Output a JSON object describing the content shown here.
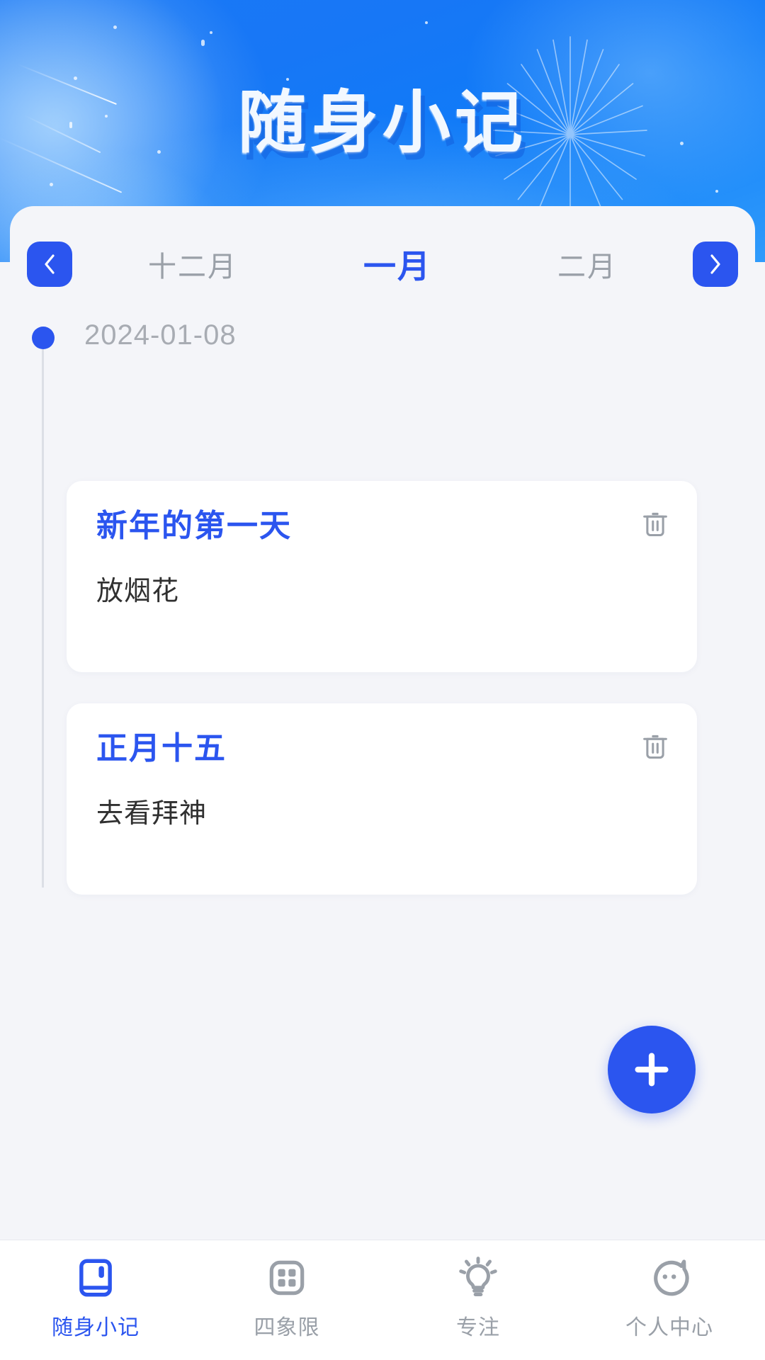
{
  "header": {
    "title": "随身小记",
    "gradient_from": "#1a78f5",
    "gradient_to": "#2f9bfb"
  },
  "theme": {
    "accent": "#2b55ef",
    "panel_bg": "#f4f5f9",
    "card_bg": "#ffffff",
    "muted_text": "#9aa0a8",
    "body_text": "#303030"
  },
  "month_nav": {
    "prev_icon": "chevron-left-icon",
    "next_icon": "chevron-right-icon",
    "months": [
      {
        "label": "十二月",
        "active": false
      },
      {
        "label": "一月",
        "active": true
      },
      {
        "label": "二月",
        "active": false
      }
    ]
  },
  "timeline": {
    "date": "2024-01-08",
    "notes": [
      {
        "title": "新年的第一天",
        "body": "放烟花",
        "delete_icon": "trash-icon"
      },
      {
        "title": "正月十五",
        "body": "去看拜神",
        "delete_icon": "trash-icon"
      }
    ]
  },
  "fab": {
    "icon": "plus-icon",
    "label": "+"
  },
  "tabbar": {
    "items": [
      {
        "label": "随身小记",
        "icon": "notebook-icon",
        "active": true
      },
      {
        "label": "四象限",
        "icon": "quadrant-grid-icon",
        "active": false
      },
      {
        "label": "专注",
        "icon": "lightbulb-icon",
        "active": false
      },
      {
        "label": "个人中心",
        "icon": "profile-face-icon",
        "active": false
      }
    ]
  }
}
